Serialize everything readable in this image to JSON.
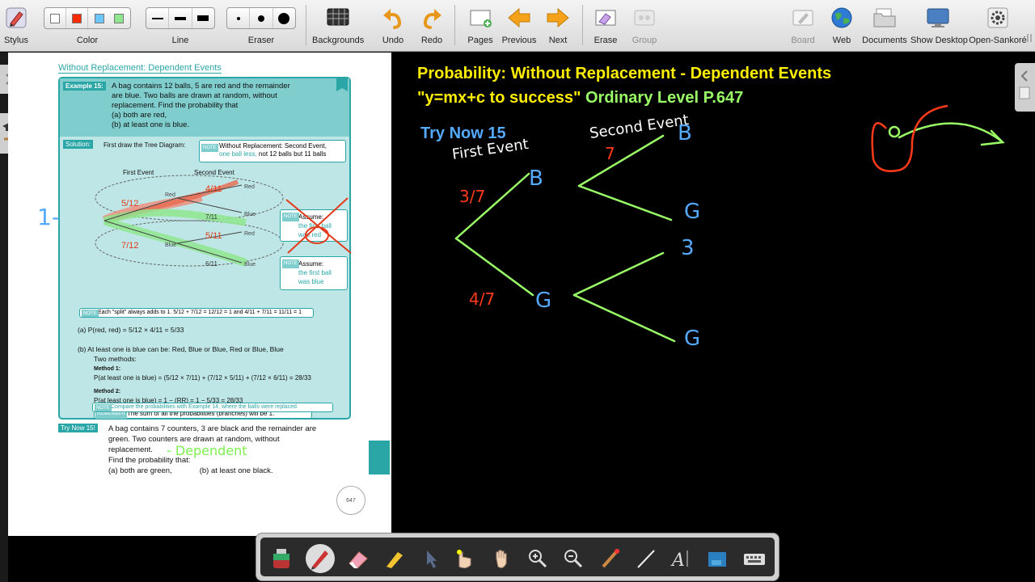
{
  "toolbar": {
    "stylus": "Stylus",
    "color": "Color",
    "line": "Line",
    "eraser": "Eraser",
    "backgrounds": "Backgrounds",
    "undo": "Undo",
    "redo": "Redo",
    "pages": "Pages",
    "previous": "Previous",
    "next": "Next",
    "erase": "Erase",
    "group": "Group",
    "board": "Board",
    "web": "Web",
    "documents": "Documents",
    "show_desktop": "Show Desktop",
    "open_sankore": "Open-Sankoré",
    "colors": [
      "#ffffff",
      "#ff2a00",
      "#6ec6ff",
      "#8ee68e"
    ]
  },
  "page": {
    "header": "Without Replacement: Dependent Events",
    "example_label": "Example 15:",
    "example_text_1": "A bag contains 12 balls, 5 are red and the remainder",
    "example_text_2": "are blue.  Two balls are drawn at random, without",
    "example_text_3": "replacement.  Find the probability that",
    "example_a": "(a)  both are red,",
    "example_b": "(b)  at least one is blue.",
    "solution_label": "Solution:",
    "solution_text": "First draw the Tree Diagram:",
    "note_label": "NOTE",
    "note1_line1": "Without Replacement: Second Event,",
    "note1_line2a": "one ball less,",
    "note1_line2b": " not 12 balls but 11 balls",
    "first_event": "First Event",
    "second_event": "Second Event",
    "tree_red": "Red",
    "tree_blue": "Blue",
    "assume1_a": "Assume:",
    "assume1_b": "the first ball",
    "assume1_c": "was red",
    "assume2_a": "Assume:",
    "assume2_b": "the first ball",
    "assume2_c": "was blue",
    "frac_5_12": "5/12",
    "frac_7_12": "7/12",
    "frac_4_11": "4/11",
    "frac_7_11": "7/11",
    "frac_5_11": "5/11",
    "frac_6_11": "6/11",
    "note2": "Each \"split\" always adds to 1.  5/12 + 7/12 = 12/12 = 1  and  4/11 + 7/11 = 11/11 = 1",
    "part_a": "(a)  P(red, red) = 5/12 × 4/11 = 5/33",
    "part_b": "(b)  At least one is blue can be:  Red, Blue or Blue, Red or Blue, Blue",
    "two_methods": "Two methods:",
    "method1": "Method 1:",
    "method1_eq": "P(at least one is blue) = (5/12 × 7/11) + (7/12 × 5/11) + (7/12 × 6/11) = 28/33",
    "method2": "Method 2:",
    "method2_eq": "P(at least one is blue) = 1 − (RR) = 1 − 5/33 = 28/33",
    "remember_label": "REMEMBER",
    "remember_text": "The sum of all the probabilities (branches) will be 1.",
    "note3": "Compare the probabilities with Example 14, where the balls were replaced.",
    "try_label": "Try Now 15!",
    "try_1": "A bag contains 7 counters, 3 are black and the remainder are",
    "try_2": "green.  Two counters are drawn at random, without",
    "try_3": "replacement.",
    "try_4": "Find the probability that:",
    "try_a": "(a) both are green,",
    "try_b": "(b) at least one black.",
    "handwritten_dependent": "- Dependent",
    "handwritten_left": "1-",
    "page_number": "647"
  },
  "board": {
    "title_1": "Probability: Without Replacement - Dependent Events",
    "title_2": "\"y=mx+c to success\"  Ordinary Level  P.647",
    "try_now": "Try Now 15",
    "first_event": "First Event",
    "second_event": "Second Event",
    "frac_first_b": "3/7",
    "frac_first_g": "4/7",
    "second_num": "7",
    "node_b1": "B",
    "node_g1": "G",
    "node_b2": "B",
    "node_g2": "G",
    "node_b3": "3",
    "node_g3": "G",
    "yellow": "#ffee00",
    "green": "#9aff66",
    "blue": "#55aaff",
    "red": "#ff3a1a"
  }
}
